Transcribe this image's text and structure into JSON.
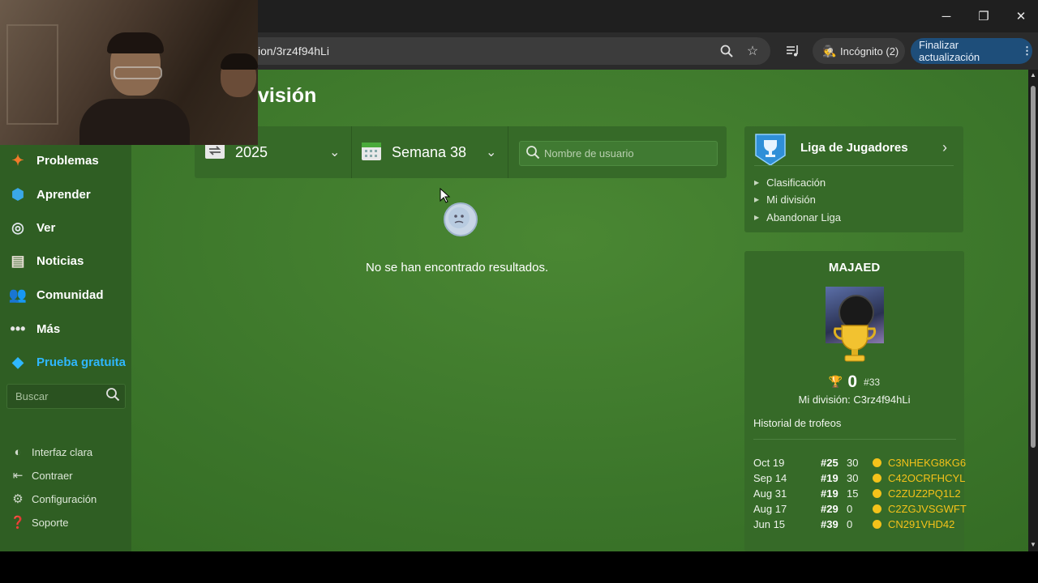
{
  "browser": {
    "url": "ion/3rz4f94hLi",
    "incognito_label": "Incógnito (2)",
    "update_label": "Finalizar actualización",
    "icons": [
      "zoom-icon",
      "bookmark-star-icon",
      "media-queue-icon",
      "incognito-icon",
      "menu-dots-icon"
    ]
  },
  "window_controls": {
    "minimize": "─",
    "restore": "❐",
    "close": "✕"
  },
  "page": {
    "heading": "visión"
  },
  "sidebar": {
    "items": [
      {
        "label": "Problemas",
        "icon": "puzzle-icon"
      },
      {
        "label": "Aprender",
        "icon": "cube-icon"
      },
      {
        "label": "Ver",
        "icon": "binoculars-icon"
      },
      {
        "label": "Noticias",
        "icon": "newspaper-icon"
      },
      {
        "label": "Comunidad",
        "icon": "people-icon"
      },
      {
        "label": "Más",
        "icon": "dots-icon"
      },
      {
        "label": "Prueba gratuita",
        "icon": "diamond-icon",
        "color": "#2fb7ff"
      }
    ],
    "search_placeholder": "Buscar",
    "footer": [
      {
        "label": "Interfaz clara",
        "icon": "half-circle-icon"
      },
      {
        "label": "Contraer",
        "icon": "collapse-icon"
      },
      {
        "label": "Configuración",
        "icon": "gear-icon"
      },
      {
        "label": "Soporte",
        "icon": "help-icon"
      }
    ]
  },
  "filters": {
    "year": "2025",
    "week": "Semana 38",
    "user_search_placeholder": "Nombre de usuario"
  },
  "results": {
    "empty_message": "No se han encontrado resultados."
  },
  "league": {
    "title": "Liga de Jugadores",
    "links": [
      "Clasificación",
      "Mi división",
      "Abandonar Liga"
    ]
  },
  "profile": {
    "username": "MAJAED",
    "trophies": "0",
    "rank": "#33",
    "division": "Mi división: C3rz4f94hLi",
    "history_title": "Historial de trofeos",
    "history": [
      {
        "date": "Oct 19",
        "rank": "#25",
        "trophies": "30",
        "code": "C3NHEKG8KG6"
      },
      {
        "date": "Sep 14",
        "rank": "#19",
        "trophies": "30",
        "code": "C42OCRFHCYL"
      },
      {
        "date": "Aug 31",
        "rank": "#19",
        "trophies": "15",
        "code": "C2ZUZ2PQ1L2"
      },
      {
        "date": "Aug 17",
        "rank": "#29",
        "trophies": "0",
        "code": "C2ZGJVSGWFT"
      },
      {
        "date": "Jun 15",
        "rank": "#39",
        "trophies": "0",
        "code": "CN291VHD42"
      }
    ]
  },
  "colors": {
    "page_green": "#3f7a2c",
    "panel_green": "#366a28",
    "gold": "#f4c21a",
    "accent_blue": "#2fb7ff"
  }
}
